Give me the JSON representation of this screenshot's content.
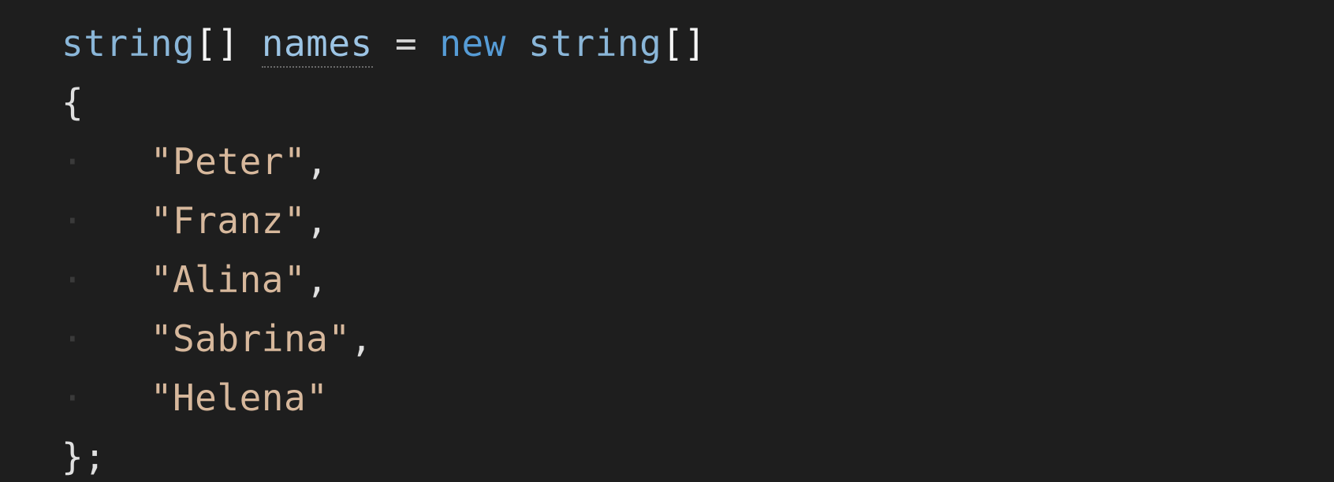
{
  "code": {
    "line1": {
      "type1": "string",
      "brackets1": "[]",
      "space1": " ",
      "var": "names",
      "space2": " ",
      "eq": "=",
      "space3": " ",
      "kw_new": "new",
      "space4": " ",
      "type2": "string",
      "brackets2": "[]"
    },
    "open_brace": "{",
    "indent_guide": "·",
    "indent_spaces": "   ",
    "items": [
      {
        "value": "\"Peter\"",
        "comma": ","
      },
      {
        "value": "\"Franz\"",
        "comma": ","
      },
      {
        "value": "\"Alina\"",
        "comma": ","
      },
      {
        "value": "\"Sabrina\"",
        "comma": ","
      },
      {
        "value": "\"Helena\"",
        "comma": ""
      }
    ],
    "close": "};"
  }
}
